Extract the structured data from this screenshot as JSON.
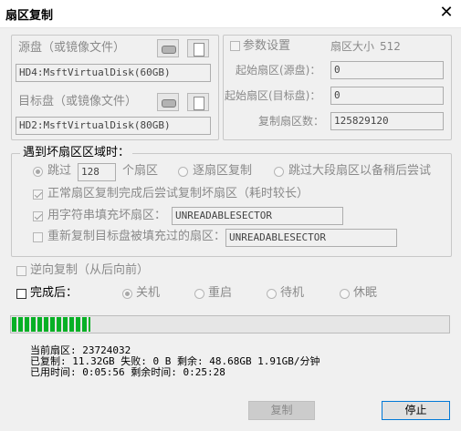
{
  "window": {
    "title": "扇区复制",
    "close_glyph": "✕"
  },
  "source": {
    "label": "源盘（或镜像文件）",
    "value": "HD4:MsftVirtualDisk(60GB)"
  },
  "target": {
    "label": "目标盘（或镜像文件）",
    "value": "HD2:MsftVirtualDisk(80GB)"
  },
  "params": {
    "checkbox_label": "参数设置",
    "sector_size_label": "扇区大小",
    "sector_size_value": "512",
    "start_src_label": "起始扇区(源盘)：",
    "start_src_value": "0",
    "start_dst_label": "起始扇区(目标盘)：",
    "start_dst_value": "0",
    "count_label": "复制扇区数：",
    "count_value": "125829120"
  },
  "bad_sector": {
    "group_label": "遇到坏扇区区域时：",
    "skip_label": "跳过",
    "skip_value": "128",
    "skip_unit": "个扇区",
    "sector_by_sector_label": "逐扇区复制",
    "skip_large_label": "跳过大段扇区以备稍后尝试",
    "retry_label": "正常扇区复制完成后尝试复制坏扇区（耗时较长）",
    "fill_label": "用字符串填充坏扇区：",
    "fill_value": "UNREADABLESECTOR",
    "recopy_label": "重新复制目标盘被填充过的扇区：",
    "recopy_value": "UNREADABLESECTOR"
  },
  "reverse_label": "逆向复制（从后向前）",
  "after": {
    "label": "完成后：",
    "options": [
      "关机",
      "重启",
      "待机",
      "休眠"
    ]
  },
  "progress": {
    "fraction": 0.18
  },
  "status": {
    "current": "当前扇区: 23724032",
    "copied": "已复制: 11.32GB  失败: 0 B  剩余: 48.68GB  1.91GB/分钟",
    "time": "已用时间:  0:05:56  剩余时间:  0:25:28"
  },
  "buttons": {
    "copy": "复制",
    "stop": "停止"
  }
}
